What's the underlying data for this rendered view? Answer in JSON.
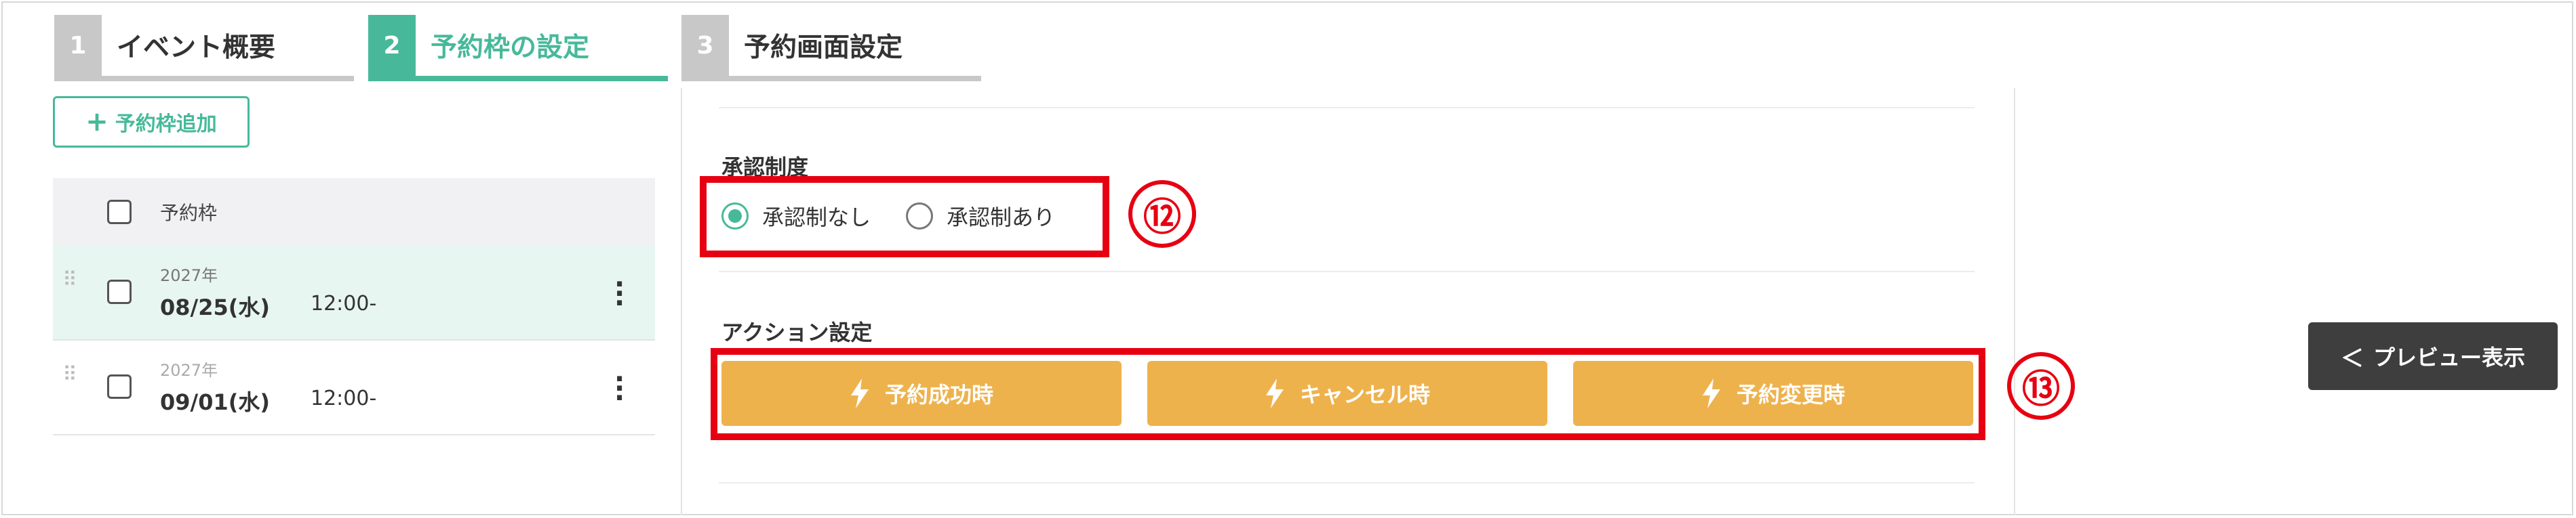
{
  "steps": [
    {
      "num": "1",
      "label": "イベント概要"
    },
    {
      "num": "2",
      "label": "予約枠の設定"
    },
    {
      "num": "3",
      "label": "予約画面設定"
    }
  ],
  "add_button": {
    "label": "予約枠追加"
  },
  "table": {
    "header": "予約枠",
    "rows": [
      {
        "year": "2027年",
        "date": "08/25(水)",
        "time": "12:00-"
      },
      {
        "year": "2027年",
        "date": "09/01(水)",
        "time": "12:00-"
      }
    ]
  },
  "approval": {
    "label": "承認制度",
    "options": [
      "承認制なし",
      "承認制あり"
    ],
    "selected": "承認制なし"
  },
  "actions": {
    "label": "アクション設定",
    "buttons": [
      "予約成功時",
      "キャンセル時",
      "予約変更時"
    ]
  },
  "annotations": [
    "⑫",
    "⑬"
  ],
  "preview_button": {
    "label": "プレビュー表示"
  },
  "colors": {
    "accent": "#47b99a",
    "action": "#eeb24d",
    "annotation": "#e60012",
    "preview_bg": "#3e3e3e"
  }
}
